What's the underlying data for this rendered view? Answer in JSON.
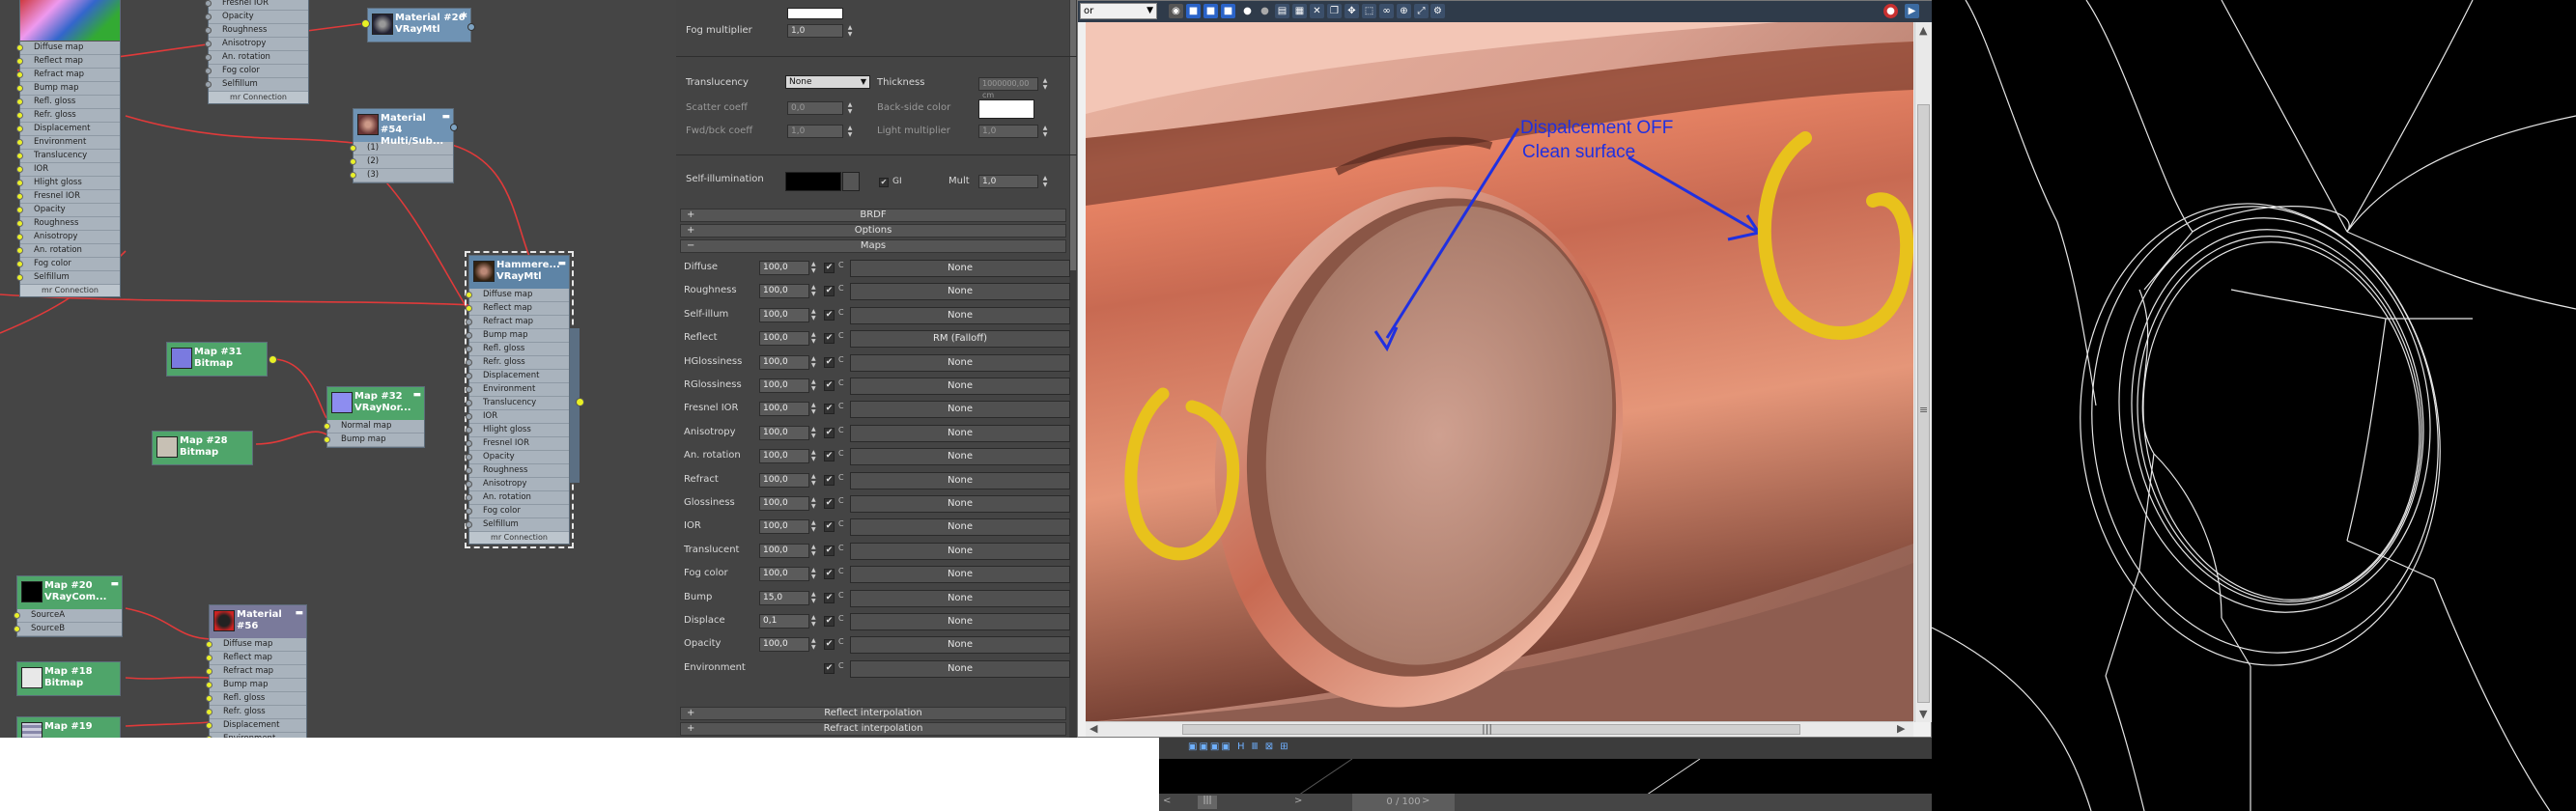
{
  "slate": {
    "node_top_left": {
      "slots": [
        "Diffuse map",
        "Reflect map",
        "Refract map",
        "Bump map",
        "Refl. gloss",
        "Refr. gloss",
        "Displacement",
        "Environment",
        "Translucency",
        "IOR",
        "Hlight gloss",
        "Fresnel IOR",
        "Opacity",
        "Roughness",
        "Anisotropy",
        "An. rotation",
        "Fog color",
        "Selfillum"
      ],
      "footer": "mr Connection"
    },
    "node_top_mid": {
      "slots": [
        "Fresnel IOR",
        "Opacity",
        "Roughness",
        "Anisotropy",
        "An. rotation",
        "Fog color",
        "Selfillum"
      ],
      "footer": "mr Connection"
    },
    "node_mat26": {
      "title1": "Material #26",
      "title2": "VRayMtl"
    },
    "node_mat54": {
      "title1": "Material #54",
      "title2": "Multi/Sub...",
      "slots": [
        "(1)",
        "(2)",
        "(3)"
      ]
    },
    "node_hammered": {
      "title1": "Hammere...",
      "title2": "VRayMtl",
      "slots": [
        "Diffuse map",
        "Reflect map",
        "Refract map",
        "Bump map",
        "Refl. gloss",
        "Refr. gloss",
        "Displacement",
        "Environment",
        "Translucency",
        "IOR",
        "Hlight gloss",
        "Fresnel IOR",
        "Opacity",
        "Roughness",
        "Anisotropy",
        "An. rotation",
        "Fog color",
        "Selfillum"
      ],
      "footer": "mr Connection"
    },
    "node_map31": {
      "title1": "Map #31",
      "title2": "Bitmap"
    },
    "node_map32": {
      "title1": "Map #32",
      "title2": "VRayNor...",
      "slots": [
        "Normal map",
        "Bump map"
      ]
    },
    "node_map28": {
      "title1": "Map #28",
      "title2": "Bitmap"
    },
    "node_map20": {
      "title1": "Map #20",
      "title2": "VRayCom...",
      "slots": [
        "SourceA",
        "SourceB"
      ]
    },
    "node_mat56": {
      "title1": "Material #56",
      "title2": "",
      "slots": [
        "Diffuse map",
        "Reflect map",
        "Refract map",
        "Bump map",
        "Refl. gloss",
        "Refr. gloss",
        "Displacement",
        "Environment"
      ]
    },
    "node_map18": {
      "title1": "Map #18",
      "title2": "Bitmap"
    },
    "node_map19": {
      "title1": "Map #19",
      "title2": ""
    },
    "colors": {
      "background": "#454545",
      "wire": "#e03a3a",
      "port_active": "#e8f025"
    }
  },
  "params": {
    "fog_multiplier_label": "Fog multiplier",
    "fog_multiplier_value": "1,0",
    "translucency_label": "Translucency",
    "translucency_value": "None",
    "thickness_label": "Thickness",
    "thickness_value": "1000000,00 cm",
    "scatter_label": "Scatter coeff",
    "scatter_value": "0,0",
    "backside_label": "Back-side color",
    "fwdbck_label": "Fwd/bck coeff",
    "fwdbck_value": "1,0",
    "light_mult_label": "Light multiplier",
    "light_mult_value": "1,0",
    "selfillum_label": "Self-illumination",
    "gi_label": "GI",
    "mult_label": "Mult",
    "mult_value": "1,0",
    "rollout_brdf": "BRDF",
    "rollout_options": "Options",
    "rollout_maps": "Maps",
    "rollout_reflect_interp": "Reflect interpolation",
    "rollout_refract_interp": "Refract interpolation",
    "map_rows": [
      {
        "label": "Diffuse",
        "amount": "100,0",
        "map": "None"
      },
      {
        "label": "Roughness",
        "amount": "100,0",
        "map": "None"
      },
      {
        "label": "Self-illum",
        "amount": "100,0",
        "map": "None"
      },
      {
        "label": "Reflect",
        "amount": "100,0",
        "map": "RM (Falloff)"
      },
      {
        "label": "HGlossiness",
        "amount": "100,0",
        "map": "None"
      },
      {
        "label": "RGlossiness",
        "amount": "100,0",
        "map": "None"
      },
      {
        "label": "Fresnel IOR",
        "amount": "100,0",
        "map": "None"
      },
      {
        "label": "Anisotropy",
        "amount": "100,0",
        "map": "None"
      },
      {
        "label": "An. rotation",
        "amount": "100,0",
        "map": "None"
      },
      {
        "label": "Refract",
        "amount": "100,0",
        "map": "None"
      },
      {
        "label": "Glossiness",
        "amount": "100,0",
        "map": "None"
      },
      {
        "label": "IOR",
        "amount": "100,0",
        "map": "None"
      },
      {
        "label": "Translucent",
        "amount": "100,0",
        "map": "None"
      },
      {
        "label": "Fog color",
        "amount": "100,0",
        "map": "None"
      },
      {
        "label": "Bump",
        "amount": "15,0",
        "map": "None"
      },
      {
        "label": "Displace",
        "amount": "0,1",
        "map": "None"
      },
      {
        "label": "Opacity",
        "amount": "100,0",
        "map": "None"
      },
      {
        "label": "Environment",
        "amount": "",
        "map": "None"
      }
    ]
  },
  "framebuffer": {
    "channel_value": "or",
    "annotation_line1": "Dispalcement OFF",
    "annotation_line2": "Clean surface",
    "colors": {
      "annotation": "#2030e0",
      "marker": "#e8c21c",
      "toolbar": "#2f3b4a"
    }
  },
  "timeline": {
    "frame_counter": "0 / 100"
  }
}
